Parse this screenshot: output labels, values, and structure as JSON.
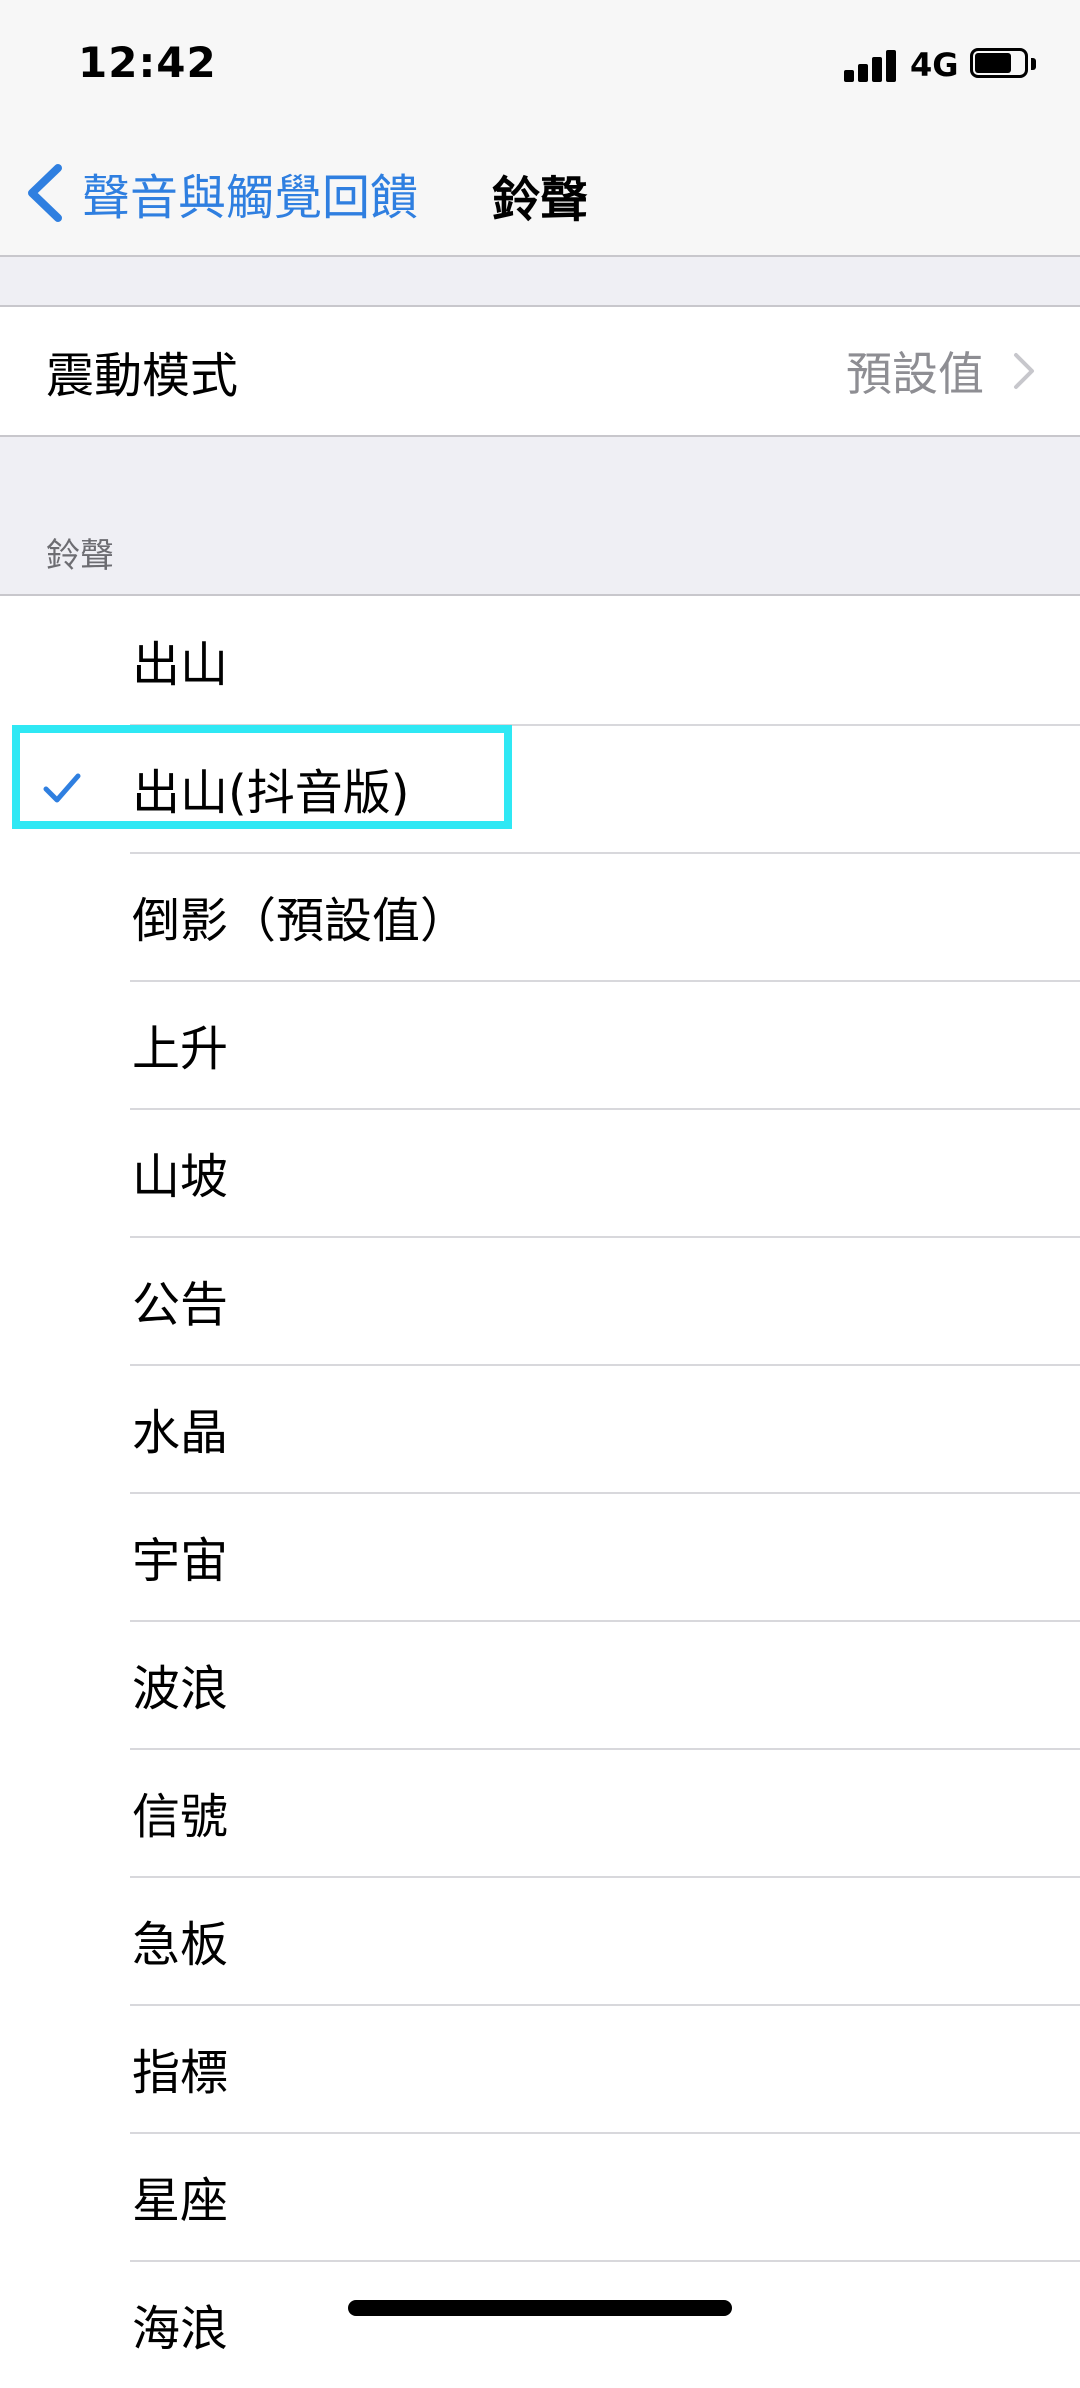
{
  "status_bar": {
    "time": "12:42",
    "network": "4G"
  },
  "nav": {
    "back_label": "聲音與觸覺回饋",
    "title": "鈴聲"
  },
  "vibration": {
    "label": "震動模式",
    "value": "預設值"
  },
  "ringtones": {
    "section_header": "鈴聲",
    "items": [
      {
        "label": "出山",
        "selected": false
      },
      {
        "label": "出山(抖音版)",
        "selected": true
      },
      {
        "label": "倒影（預設值）",
        "selected": false
      },
      {
        "label": "上升",
        "selected": false
      },
      {
        "label": "山坡",
        "selected": false
      },
      {
        "label": "公告",
        "selected": false
      },
      {
        "label": "水晶",
        "selected": false
      },
      {
        "label": "宇宙",
        "selected": false
      },
      {
        "label": "波浪",
        "selected": false
      },
      {
        "label": "信號",
        "selected": false
      },
      {
        "label": "急板",
        "selected": false
      },
      {
        "label": "指標",
        "selected": false
      },
      {
        "label": "星座",
        "selected": false
      },
      {
        "label": "海浪",
        "selected": false
      }
    ]
  },
  "colors": {
    "accent": "#2f7fe0",
    "highlight": "#2fe8f4"
  },
  "icons": {
    "back": "chevron-left-icon",
    "disclosure": "chevron-right-icon",
    "selected": "checkmark-icon"
  }
}
